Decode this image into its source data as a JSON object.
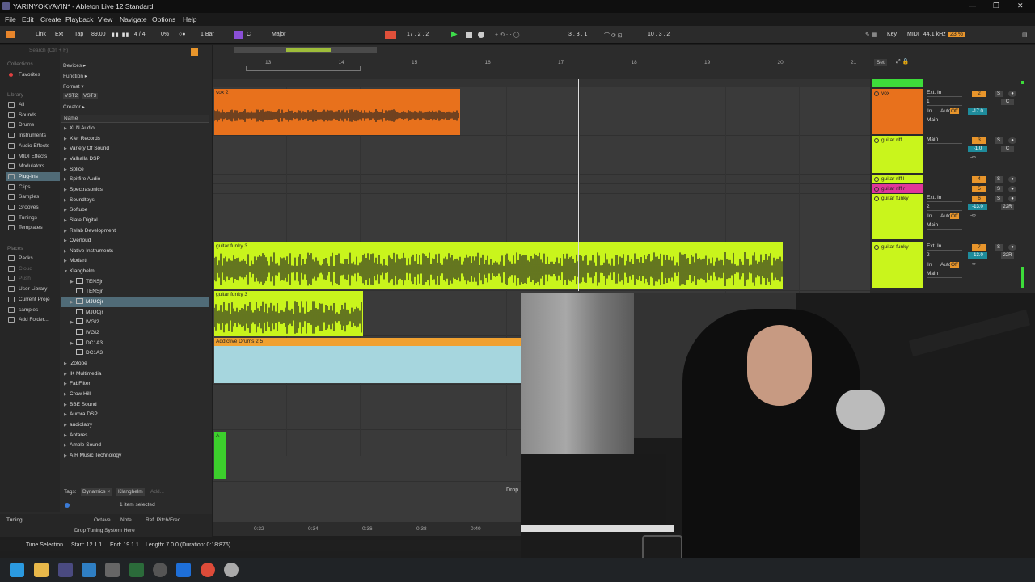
{
  "window": {
    "title": "YARINYOKYAYIN* - Ableton Live 12 Standard"
  },
  "menu": [
    "File",
    "Edit",
    "Create",
    "Playback",
    "View",
    "Navigate",
    "Options",
    "Help"
  ],
  "control_bar": {
    "link": "Link",
    "ext": "Ext",
    "tap": "Tap",
    "tempo": "89.00",
    "time_sig": "4 / 4",
    "nudge_pct": "0%",
    "quantize": "1 Bar",
    "key": "C",
    "scale": "Major",
    "position": "17 .  2 .  2",
    "loop_start": "3 .  3 .  1",
    "loop_len": "10 .  3 .  2",
    "key_label": "Key",
    "midi_label": "MIDI",
    "sample_rate": "44.1 kHz",
    "cpu": "23 %"
  },
  "browser": {
    "search_placeholder": "Search (Ctrl + F)",
    "collections_title": "Collections",
    "favorites": "Favorites",
    "library_title": "Library",
    "library_items": [
      "All",
      "Sounds",
      "Drums",
      "Instruments",
      "Audio Effects",
      "MIDI Effects",
      "Modulators",
      "Plug-Ins",
      "Clips",
      "Samples",
      "Grooves",
      "Tunings",
      "Templates"
    ],
    "places_title": "Places",
    "places_items": [
      "Packs",
      "Cloud",
      "Push",
      "User Library",
      "Current Proje",
      "samples",
      "Add Folder..."
    ],
    "filters": {
      "devices": "Devices ▸",
      "function": "Function ▸",
      "format": "Format ▾",
      "vst2": "VST2",
      "vst3": "VST3",
      "creator": "Creator ▸"
    },
    "name_header": "Name",
    "list": [
      "XLN Audio",
      "Xfer Records",
      "Variety Of Sound",
      "Valhalla DSP",
      "Splice",
      "Spitfire Audio",
      "Spectrasonics",
      "Soundtoys",
      "Softube",
      "Slate Digital",
      "Relab Development",
      "Overloud",
      "Native Instruments",
      "Modartt",
      "Klanghelm"
    ],
    "klanghelm_children": [
      "TENSjr",
      "TENSjr",
      "MJUCjr",
      "MJUCjr",
      "IVGI2",
      "IVGI2",
      "DC1A3",
      "DC1A3"
    ],
    "list_after": [
      "iZotope",
      "IK Multimedia",
      "FabFilter",
      "Crow Hill",
      "BBE Sound",
      "Aurora DSP",
      "audiolatry",
      "Antares",
      "Ample Sound",
      "AIR Music Technology"
    ],
    "tags_label": "Tags:",
    "tags": [
      "Dynamics ×",
      "Klanghelm"
    ],
    "tags_add": "Add...",
    "selected_count": "1 item selected"
  },
  "tuning_panel": {
    "title": "Tuning",
    "col_octave": "Octave",
    "col_note": "Note",
    "col_ref": "Ref. Pitch/Freq",
    "drop_hint": "Drop Tuning System Here"
  },
  "arrangement": {
    "bar_labels": [
      "13",
      "14",
      "15",
      "16",
      "17",
      "18",
      "19",
      "20",
      "21"
    ],
    "time_labels": [
      "0:32",
      "0:34",
      "0:36",
      "0:38",
      "0:40"
    ],
    "set_label": "Set",
    "drop_text": "Drop",
    "clips": [
      {
        "name": "vox 2",
        "color": "#e8711c"
      },
      {
        "name": "guitar funky 3",
        "color": "#c9f51c"
      },
      {
        "name": "guitar funky 3",
        "color": "#c9f51c"
      },
      {
        "name": "Addictive Drums 2 5",
        "color": "#a6d6de"
      },
      {
        "name": "A",
        "color": "#3ccf2c"
      }
    ]
  },
  "tracks": [
    {
      "name": "vox",
      "color": "#e8711c",
      "input": "Ext. In",
      "channel": "1",
      "number": "2",
      "pan": "C",
      "vol": "-17.0",
      "monitor": [
        "In",
        "Auto",
        "Off"
      ],
      "out": "Main"
    },
    {
      "name": "guitar riff",
      "color": "#c9f51c",
      "input": "Main",
      "number": "3",
      "pan": "C",
      "vol": "-1.0",
      "send": "-∞"
    },
    {
      "name": "guitar riff l",
      "color": "#c9f51c",
      "number": "4"
    },
    {
      "name": "guitar riff r",
      "color": "#e0359a",
      "number": "5"
    },
    {
      "name": "guitar funky",
      "color": "#c9f51c",
      "input": "Ext. In",
      "channel": "2",
      "number": "6",
      "pan": "22R",
      "vol": "-13.0",
      "send": "-∞",
      "monitor": [
        "In",
        "Auto",
        "Off"
      ],
      "out": "Main"
    },
    {
      "name": "guitar funky",
      "color": "#c9f51c",
      "input": "Ext. In",
      "channel": "2",
      "number": "7",
      "pan": "22R",
      "vol": "-13.0",
      "send": "-∞",
      "monitor": [
        "In",
        "Auto",
        "Off"
      ],
      "out": "Main"
    }
  ],
  "status_bar": {
    "time_sel": "Time Selection",
    "start": "Start: 12.1.1",
    "end": "End: 19.1.1",
    "length": "Length: 7.0.0 (Duration: 0:18:876)"
  }
}
